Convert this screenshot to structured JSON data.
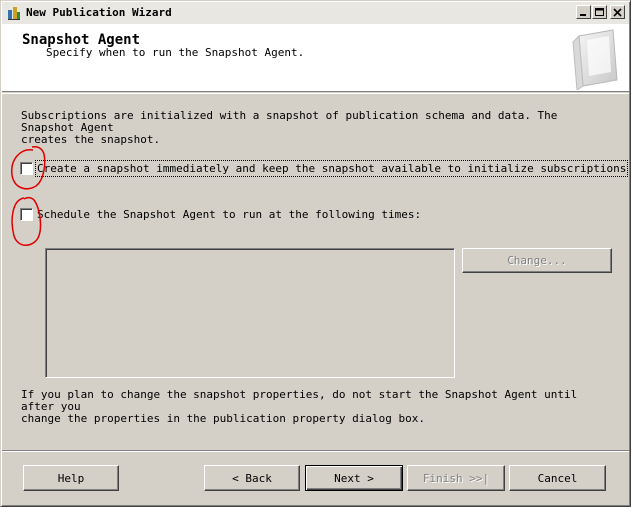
{
  "window": {
    "title": "New Publication Wizard",
    "controls": {
      "minimize_icon": "minimize-icon",
      "maximize_icon": "maximize-icon",
      "close_icon": "close-icon"
    }
  },
  "header": {
    "title": "Snapshot Agent",
    "subtitle": "Specify when to run the Snapshot Agent."
  },
  "body": {
    "intro": "Subscriptions are initialized with a snapshot of publication schema and data. The Snapshot Agent\ncreates the snapshot.",
    "options": [
      {
        "label": "Create a snapshot immediately and keep the snapshot available to initialize subscriptions",
        "checked": false
      },
      {
        "label": "Schedule the Snapshot Agent to run at the following times:",
        "checked": false
      }
    ],
    "change_button": "Change...",
    "note": "If you plan to change the snapshot properties, do not start the Snapshot Agent until after you\nchange the properties in the publication property dialog box."
  },
  "footer": {
    "help": "Help",
    "back": "< Back",
    "next": "Next >",
    "finish": "Finish >>|",
    "cancel": "Cancel"
  },
  "colors": {
    "face": "#d4d0c8",
    "header_bg": "#ffffff",
    "disabled_text": "#808080",
    "annotation": "#e00000"
  }
}
